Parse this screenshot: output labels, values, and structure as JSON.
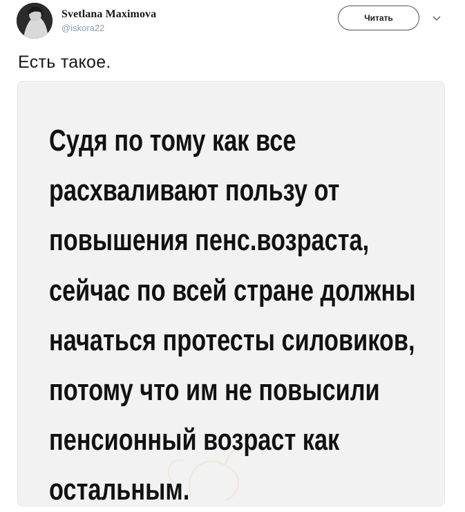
{
  "author": {
    "display_name": "Svetlana Maximova",
    "handle": "@iskora22",
    "avatar_icon": "user-avatar"
  },
  "header": {
    "follow_label": "Читать",
    "more_icon": "chevron-down-icon"
  },
  "tweet": {
    "text": "Есть такое."
  },
  "media": {
    "lines": [
      "Судя по тому как все",
      "расхваливают пользу от",
      "повышения пенс.возраста,",
      "сейчас по всей стране должны",
      "начаться протесты силовиков,",
      "потому что им не повысили",
      "пенсионный возраст как",
      "остальным."
    ]
  },
  "colors": {
    "text": "#14171a",
    "muted": "#8f9aa3",
    "border": "#e1e8ed",
    "image_bg": "#f2f2f2"
  }
}
